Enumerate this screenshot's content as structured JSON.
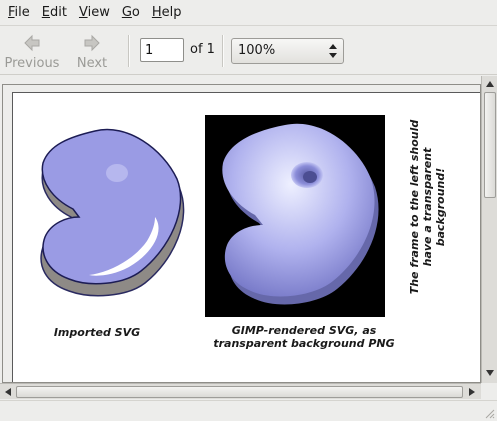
{
  "menu": [
    {
      "underline": "F",
      "rest": "ile"
    },
    {
      "underline": "E",
      "rest": "dit"
    },
    {
      "underline": "V",
      "rest": "iew"
    },
    {
      "underline": "G",
      "rest": "o"
    },
    {
      "underline": "H",
      "rest": "elp"
    }
  ],
  "toolbar": {
    "previous_label": "Previous",
    "next_label": "Next",
    "page_value": "1",
    "of_label": "of 1",
    "zoom_value": "100%"
  },
  "page": {
    "caption_left": "Imported SVG",
    "caption_center_line1": "GIMP-rendered SVG, as",
    "caption_center_line2": "transparent background PNG",
    "side_note_line1": "The frame to the left should",
    "side_note_line2": "have a transparent background!"
  },
  "colors": {
    "logo_fill": "#9a9be4",
    "logo_shadow": "#8e8a86",
    "render_bg": "#000000"
  }
}
